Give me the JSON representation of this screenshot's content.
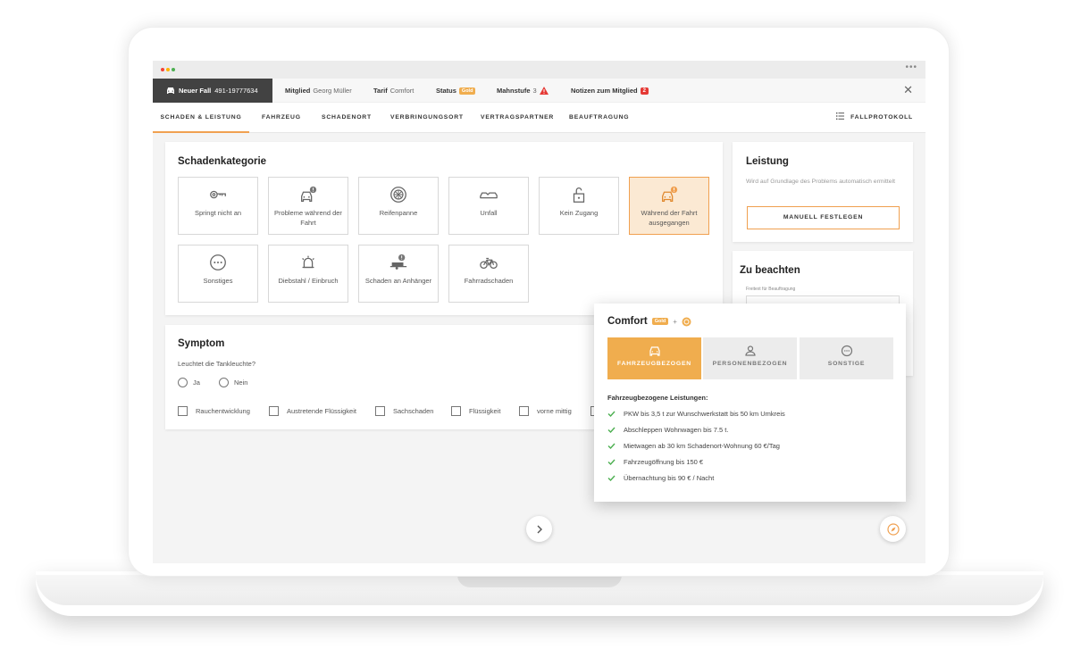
{
  "casebar": {
    "new_case_label": "Neuer Fall",
    "case_number": "491-19777634",
    "member_key": "Mitglied",
    "member_value": "Georg Müller",
    "tariff_key": "Tarif",
    "tariff_value": "Comfort",
    "status_key": "Status",
    "status_badge": "Gold",
    "dunning_key": "Mahnstufe",
    "dunning_value": "3",
    "notes_label": "Notizen zum Mitglied",
    "notes_count": "2"
  },
  "tabs": [
    "SCHADEN & LEISTUNG",
    "FAHRZEUG",
    "SCHADENORT",
    "VERBRINGUNGSORT",
    "VERTRAGSPARTNER",
    "BEAUFTRAGUNG"
  ],
  "protocol_label": "FALLPROTOKOLL",
  "damage": {
    "title": "Schadenkategorie",
    "categories": [
      {
        "label": "Springt nicht an",
        "icon": "key-icon"
      },
      {
        "label": "Probleme während der Fahrt",
        "icon": "car-warning-icon"
      },
      {
        "label": "Reifenpanne",
        "icon": "tire-icon"
      },
      {
        "label": "Unfall",
        "icon": "crash-icon"
      },
      {
        "label": "Kein Zugang",
        "icon": "lock-open-icon"
      },
      {
        "label": "Während der Fahrt ausgegangen",
        "icon": "car-warning-icon",
        "selected": true
      },
      {
        "label": "Sonstiges",
        "icon": "more-icon"
      },
      {
        "label": "Diebstahl / Einbruch",
        "icon": "alarm-icon"
      },
      {
        "label": "Schaden an Anhänger",
        "icon": "trailer-warning-icon"
      },
      {
        "label": "Fahrradschaden",
        "icon": "bicycle-icon"
      }
    ]
  },
  "service": {
    "title": "Leistung",
    "description": "Wird auf Grundlage des Problems automatisch ermittelt",
    "button": "MANUELL FESTLEGEN"
  },
  "notes": {
    "title": "Zu beachten",
    "field_label": "Freitext für Beauftragung"
  },
  "symptom": {
    "title": "Symptom",
    "question": "Leuchtet die Tankleuchte?",
    "options": [
      "Ja",
      "Nein"
    ],
    "checkboxes": [
      "Rauchentwicklung",
      "Austretende Flüssigkeit",
      "Sachschaden",
      "Flüssigkeit",
      "vorne mittig"
    ]
  },
  "popup": {
    "title": "Comfort",
    "badge": "Gold",
    "plus": "+",
    "tabs": [
      "FAHRZEUGBEZOGEN",
      "PERSONENBEZOGEN",
      "SONSTIGE"
    ],
    "section_title": "Fahrzeugbezogene Leistungen:",
    "benefits": [
      "PKW bis 3,5 t zur Wunschwerkstatt bis 50 km Umkreis",
      "Abschleppen Wohnwagen bis 7.5 t.",
      "Mietwagen ab 30 km Schadenort-Wohnung 60 €/Tag",
      "Fahrzeugöffnung bis 150 €",
      "Übernachtung bis 90 € / Nacht"
    ]
  },
  "colors": {
    "accent": "#f0a050",
    "gold": "#f0ad4e",
    "alert": "#e53935",
    "check": "#4caf50"
  }
}
